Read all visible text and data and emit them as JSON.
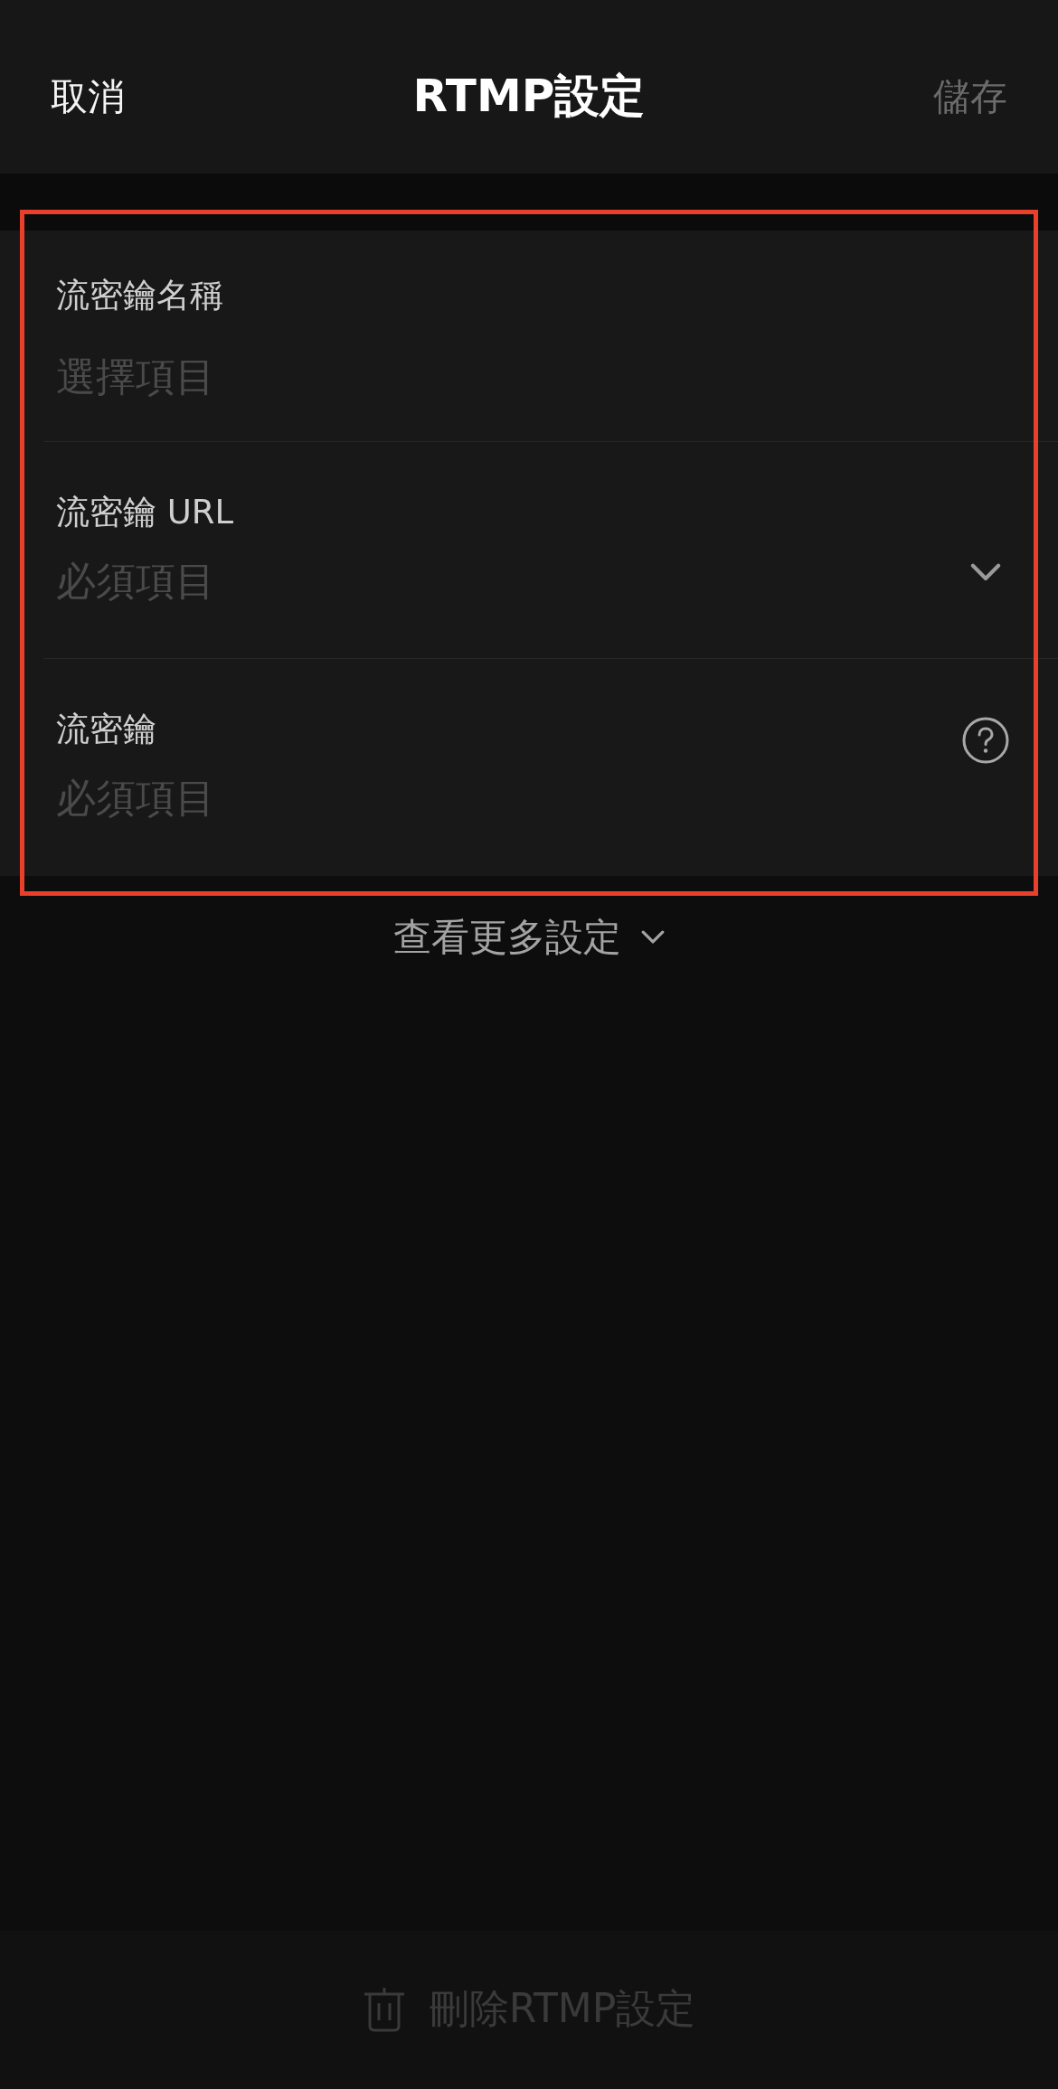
{
  "header": {
    "cancel": {
      "label": "取消"
    },
    "title": "RTMP設定",
    "save": {
      "label": "儲存",
      "disabled": true
    }
  },
  "form": {
    "highlighted": true,
    "fields": [
      {
        "kind": "plain",
        "label": "流密鑰名稱",
        "placeholder": "選擇項目"
      },
      {
        "kind": "dropdown",
        "label": "流密鑰 URL",
        "placeholder": "必須項目"
      },
      {
        "kind": "help",
        "label": "流密鑰",
        "placeholder": "必須項目"
      }
    ]
  },
  "more_settings": {
    "label": "查看更多設定",
    "expanded": false
  },
  "delete": {
    "label": "刪除RTMP設定",
    "disabled": true
  }
}
